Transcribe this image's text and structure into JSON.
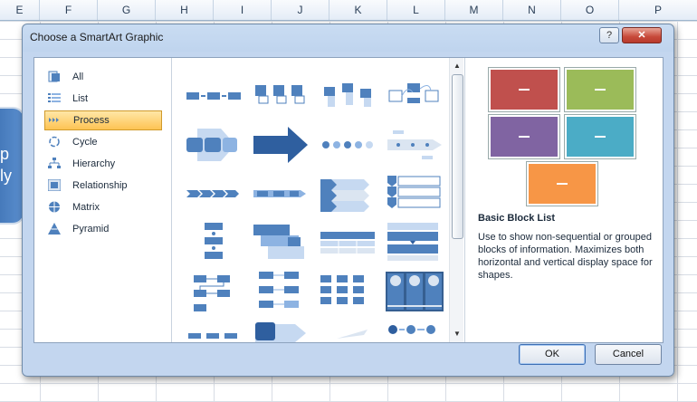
{
  "spreadsheet": {
    "columns": [
      "E",
      "F",
      "G",
      "H",
      "I",
      "J",
      "K",
      "L",
      "M",
      "N",
      "O",
      "P"
    ],
    "shape_text_lines": [
      "p",
      "ly"
    ]
  },
  "dialog": {
    "title": "Choose a SmartArt Graphic",
    "help_label": "?",
    "close_label": "✕",
    "ok_label": "OK",
    "cancel_label": "Cancel"
  },
  "categories": [
    {
      "label": "All",
      "icon": "all-icon"
    },
    {
      "label": "List",
      "icon": "list-icon"
    },
    {
      "label": "Process",
      "icon": "process-icon",
      "selected": true
    },
    {
      "label": "Cycle",
      "icon": "cycle-icon"
    },
    {
      "label": "Hierarchy",
      "icon": "hierarchy-icon"
    },
    {
      "label": "Relationship",
      "icon": "relationship-icon"
    },
    {
      "label": "Matrix",
      "icon": "matrix-icon"
    },
    {
      "label": "Pyramid",
      "icon": "pyramid-icon"
    }
  ],
  "preview": {
    "title": "Basic Block List",
    "description": "Use to show non-sequential or grouped blocks of information. Maximizes both horizontal and vertical display space for shapes.",
    "block_colors": [
      "#c0504d",
      "#9bbb59",
      "#8064a2",
      "#4bacc6",
      "#f79646"
    ]
  },
  "colors": {
    "accent_blue": "#4f81bd",
    "selected_bg": "#fdc353"
  }
}
